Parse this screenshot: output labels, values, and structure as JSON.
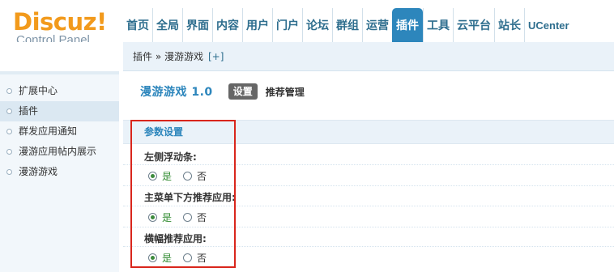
{
  "logo": {
    "title": "Discuz!",
    "subtitle": "Control Panel"
  },
  "nav": [
    "首页",
    "全局",
    "界面",
    "内容",
    "用户",
    "门户",
    "论坛",
    "群组",
    "运营",
    "插件",
    "工具",
    "云平台",
    "站长",
    "UCenter"
  ],
  "nav_active": "插件",
  "sidebar": {
    "items": [
      "扩展中心",
      "插件",
      "群发应用通知",
      "漫游应用帖内展示",
      "漫游游戏"
    ],
    "active": "插件"
  },
  "breadcrumb": {
    "path": "插件 » 漫游游戏",
    "add": "[+]"
  },
  "main": {
    "plugin_name": "漫游游戏 1.0",
    "tabs": {
      "active": "设置",
      "other": "推荐管理"
    },
    "section_title": "参数设置",
    "settings": [
      {
        "label": "左侧浮动条:",
        "yes": "是",
        "no": "否",
        "selected": "是"
      },
      {
        "label": "主菜单下方推荐应用:",
        "yes": "是",
        "no": "否",
        "selected": "是"
      },
      {
        "label": "横幅推荐应用:",
        "yes": "是",
        "no": "否",
        "selected": "是"
      }
    ]
  },
  "colors": {
    "accent": "#2d86bc",
    "logo": "#f29a1c",
    "highlight_box": "#d9261c"
  }
}
